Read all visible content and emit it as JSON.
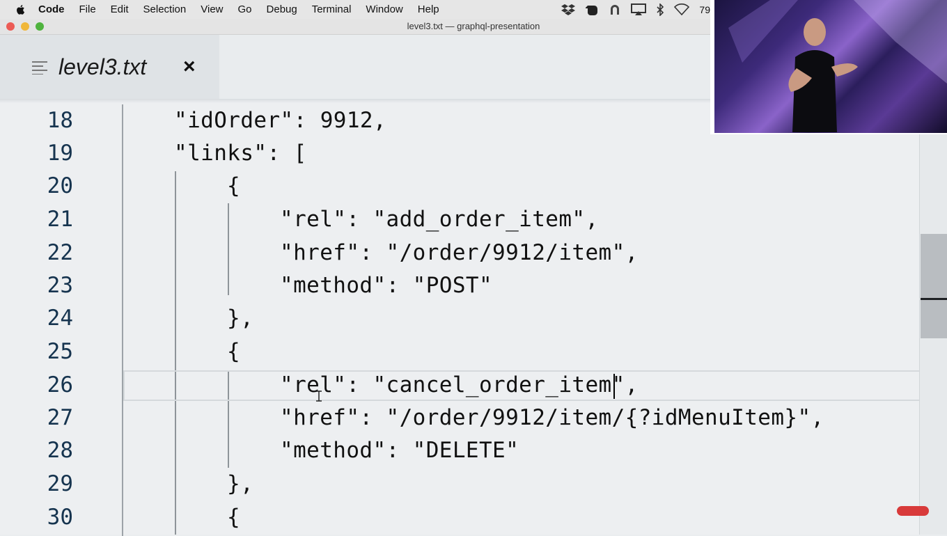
{
  "menubar": {
    "apple_icon": "apple-icon",
    "items": [
      "Code",
      "File",
      "Edit",
      "Selection",
      "View",
      "Go",
      "Debug",
      "Terminal",
      "Window",
      "Help"
    ],
    "battery_text": "79"
  },
  "window": {
    "title": "level3.txt — graphql-presentation"
  },
  "tab": {
    "title": "level3.txt",
    "close_label": "×",
    "icon": "lines-icon"
  },
  "editor": {
    "lines": [
      {
        "number": "18",
        "text": "\"idOrder\": 9912,"
      },
      {
        "number": "19",
        "text": "\"links\": ["
      },
      {
        "number": "20",
        "text": "{"
      },
      {
        "number": "21",
        "text": "\"rel\": \"add_order_item\","
      },
      {
        "number": "22",
        "text": "\"href\": \"/order/9912/item\","
      },
      {
        "number": "23",
        "text": "\"method\": \"POST\""
      },
      {
        "number": "24",
        "text": "},"
      },
      {
        "number": "25",
        "text": "{"
      },
      {
        "number": "26",
        "text": "\"rel\": \"cancel_order_item\","
      },
      {
        "number": "27",
        "text": "\"href\": \"/order/9912/item/{?idMenuItem}\","
      },
      {
        "number": "28",
        "text": "\"method\": \"DELETE\""
      },
      {
        "number": "29",
        "text": "},"
      },
      {
        "number": "30",
        "text": "{"
      }
    ]
  },
  "colors": {
    "editor_bg": "#edeff1",
    "line_number": "#16344f",
    "close_dot": "#ec5b55",
    "minimize_dot": "#f0b73a",
    "zoom_dot": "#4fb33e"
  }
}
